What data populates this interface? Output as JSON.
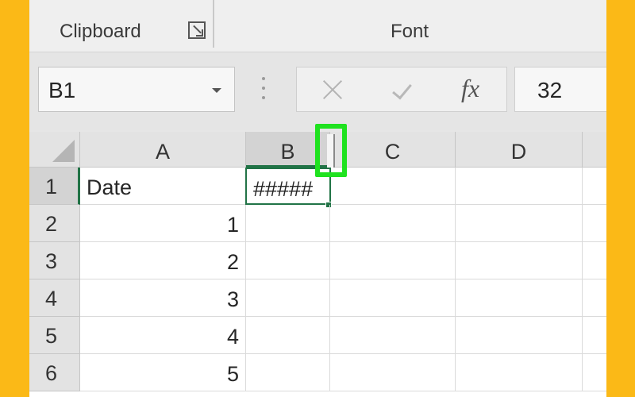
{
  "ribbon": {
    "clipboard_label": "Clipboard",
    "font_label": "Font"
  },
  "formula_bar": {
    "name_box": "B1",
    "formula_value": "32",
    "fx_label": "fx"
  },
  "columns": [
    "A",
    "B",
    "C",
    "D"
  ],
  "rows": [
    {
      "number": "1",
      "a": "Date",
      "b": "#####"
    },
    {
      "number": "2",
      "a": "1",
      "b": ""
    },
    {
      "number": "3",
      "a": "2",
      "b": ""
    },
    {
      "number": "4",
      "a": "3",
      "b": ""
    },
    {
      "number": "5",
      "a": "4",
      "b": ""
    },
    {
      "number": "6",
      "a": "5",
      "b": ""
    }
  ],
  "colors": {
    "background": "#fbb917",
    "selection": "#217346",
    "highlight": "#1fe21f"
  }
}
